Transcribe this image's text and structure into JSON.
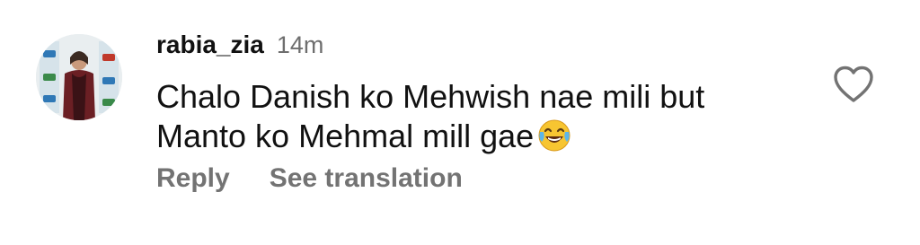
{
  "comment": {
    "username": "rabia_zia",
    "timestamp": "14m",
    "text": "Chalo Danish ko Mehwish nae mili but\nManto ko Mehmal mill gae",
    "emoji": "tears-of-joy-emoji",
    "actions": {
      "reply_label": "Reply",
      "translate_label": "See translation"
    },
    "like_icon": "heart-outline-icon",
    "avatar_icon": "profile-photo"
  },
  "colors": {
    "text": "#111111",
    "muted": "#737373",
    "timestamp": "#6e6e6e",
    "background": "#ffffff"
  }
}
